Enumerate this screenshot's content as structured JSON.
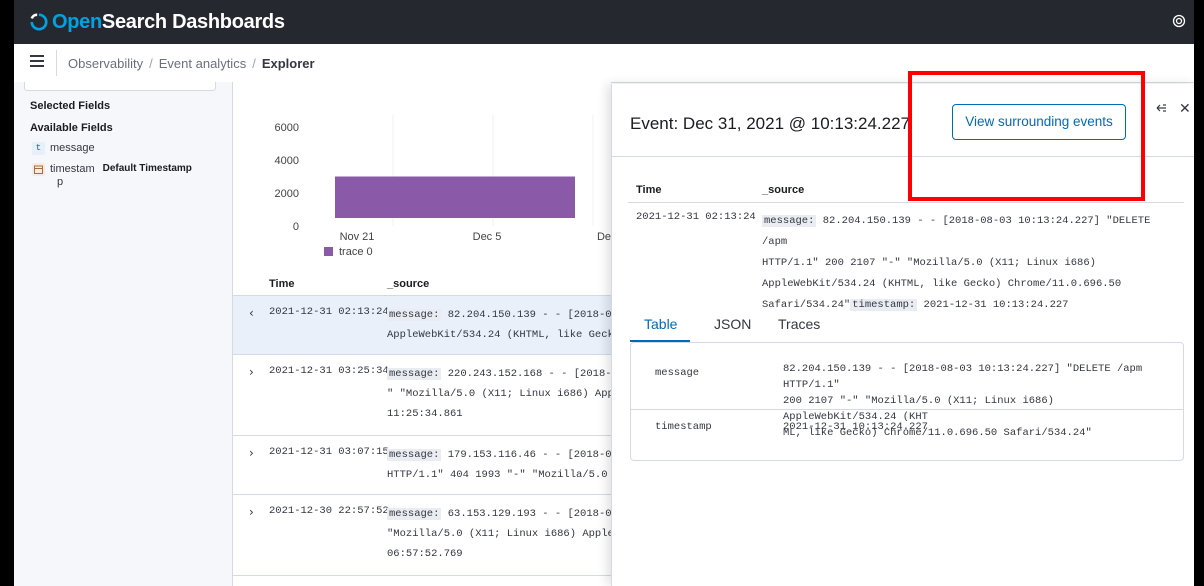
{
  "app": {
    "title_prefix": "Open",
    "title_suffix": "Search Dashboards"
  },
  "breadcrumbs": [
    "Observability",
    "Event analytics",
    "Explorer"
  ],
  "sidebar": {
    "selected_fields_title": "Selected Fields",
    "available_fields_title": "Available Fields",
    "fields": [
      {
        "name": "message",
        "type_icon": "t"
      },
      {
        "name": "timestam",
        "name_wrap": "p",
        "type_icon": "calendar-icon",
        "badge": "Default Timestamp"
      }
    ]
  },
  "chart_data": {
    "type": "bar",
    "x": [
      "Nov 21",
      "Dec 5",
      "De"
    ],
    "y_ticks": [
      "6000",
      "4000",
      "2000",
      "0"
    ],
    "series": [
      {
        "name": "trace 0",
        "values": [
          3000
        ]
      }
    ],
    "colors": {
      "trace 0": "#8a5aa8"
    }
  },
  "table": {
    "headers": [
      "Time",
      "_source"
    ],
    "rows": [
      {
        "time": "2021-12-31 02:13:24",
        "lines": [
          [
            "message:",
            "82.204.150.139 - - [2018-08"
          ],
          [
            "",
            "AppleWebKit/534.24 (KHTML, like Gecko"
          ]
        ],
        "expanded": true
      },
      {
        "time": "2021-12-31 03:25:34",
        "lines": [
          [
            "message:",
            "220.243.152.168 - - [2018-08"
          ],
          [
            "",
            "\" \"Mozilla/5.0 (X11; Linux i686) Appl"
          ],
          [
            "",
            "11:25:34.861"
          ]
        ],
        "expanded": false
      },
      {
        "time": "2021-12-31 03:07:15",
        "lines": [
          [
            "message:",
            "179.153.116.46 - - [2018-08-"
          ],
          [
            "",
            "HTTP/1.1\" 404 1993 \"-\" \"Mozilla/5.0 ("
          ]
        ],
        "expanded": false
      },
      {
        "time": "2021-12-30 22:57:52",
        "lines": [
          [
            "message:",
            "63.153.129.193 - - [2018-08-"
          ],
          [
            "",
            "\"Mozilla/5.0 (X11; Linux i686) AppleW"
          ],
          [
            "",
            "06:57:52.769"
          ]
        ],
        "expanded": false
      }
    ]
  },
  "flyout": {
    "title": "Event: Dec 31, 2021 @ 10:13:24.227",
    "surround_button": "View surrounding events",
    "headers": [
      "Time",
      "_source"
    ],
    "time": "2021-12-31 02:13:24",
    "source_message_key": "message:",
    "source_message_lines": [
      "82.204.150.139 - - [2018-08-03 10:13:24.227] \"DELETE /apm",
      "HTTP/1.1\" 200 2107 \"-\" \"Mozilla/5.0 (X11; Linux i686)",
      "AppleWebKit/534.24 (KHTML, like Gecko) Chrome/11.0.696.50",
      "Safari/534.24\""
    ],
    "source_timestamp_key": "timestamp:",
    "source_timestamp_value": "2021-12-31 10:13:24.227",
    "tabs": [
      "Table",
      "JSON",
      "Traces"
    ],
    "active_tab": "Table",
    "fields": [
      {
        "key": "message",
        "value_lines": [
          "82.204.150.139 - - [2018-08-03 10:13:24.227] \"DELETE /apm HTTP/1.1\"",
          "200 2107 \"-\" \"Mozilla/5.0 (X11; Linux i686) AppleWebKit/534.24 (KHT",
          "ML, like Gecko) Chrome/11.0.696.50 Safari/534.24\""
        ]
      },
      {
        "key": "timestamp",
        "value_lines": [
          "2021-12-31 10:13:24.227"
        ]
      }
    ]
  },
  "colors": {
    "topbar": "#25282f",
    "accent": "#006bb4",
    "highlight_box": "#ff0000",
    "bar": "#8a5aa8"
  }
}
